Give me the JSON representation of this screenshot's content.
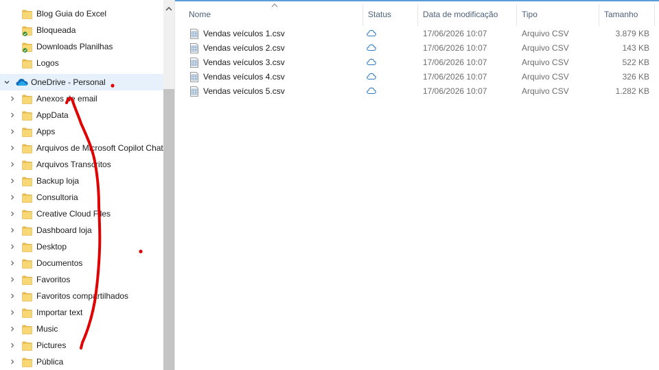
{
  "nav": {
    "items_above": [
      {
        "label": "Blog Guia do Excel",
        "status": "none"
      },
      {
        "label": "Bloqueada",
        "status": "synced"
      },
      {
        "label": "Downloads Planilhas",
        "status": "synced"
      },
      {
        "label": "Logos",
        "status": "none"
      }
    ],
    "onedrive": {
      "label": "OneDrive - Personal",
      "icon": "onedrive-cloud-icon",
      "expanded": true
    },
    "onedrive_children": [
      "Anexos de email",
      "AppData",
      "Apps",
      "Arquivos de Microsoft Copilot Chat",
      "Arquivos Transcritos",
      "Backup loja",
      "Consultoria",
      "Creative Cloud Files",
      "Dashboard loja",
      "Desktop",
      "Documentos",
      "Favoritos",
      "Favoritos compartilhados",
      "Importar text",
      "Music",
      "Pictures",
      "Pública"
    ]
  },
  "columns": {
    "name": "Nome",
    "status": "Status",
    "date": "Data de modificação",
    "type": "Tipo",
    "size": "Tamanho"
  },
  "files": [
    {
      "name": "Vendas veículos 1.csv",
      "status": "cloud",
      "date": "17/06/2026 10:07",
      "type": "Arquivo CSV",
      "size": "3.879 KB"
    },
    {
      "name": "Vendas veículos 2.csv",
      "status": "cloud",
      "date": "17/06/2026 10:07",
      "type": "Arquivo CSV",
      "size": "143 KB"
    },
    {
      "name": "Vendas veículos 3.csv",
      "status": "cloud",
      "date": "17/06/2026 10:07",
      "type": "Arquivo CSV",
      "size": "522 KB"
    },
    {
      "name": "Vendas veículos 4.csv",
      "status": "cloud",
      "date": "17/06/2026 10:07",
      "type": "Arquivo CSV",
      "size": "326 KB"
    },
    {
      "name": "Vendas veículos 5.csv",
      "status": "cloud",
      "date": "17/06/2026 10:07",
      "type": "Arquivo CSV",
      "size": "1.282 KB"
    }
  ],
  "colors": {
    "folder": "#f8d775",
    "folder_dark": "#e8b84a",
    "selection": "#e6f1fb",
    "cloud_status": "#2b79c2",
    "annotation": "#e00000",
    "sync_badge": "#2e8b2e"
  }
}
